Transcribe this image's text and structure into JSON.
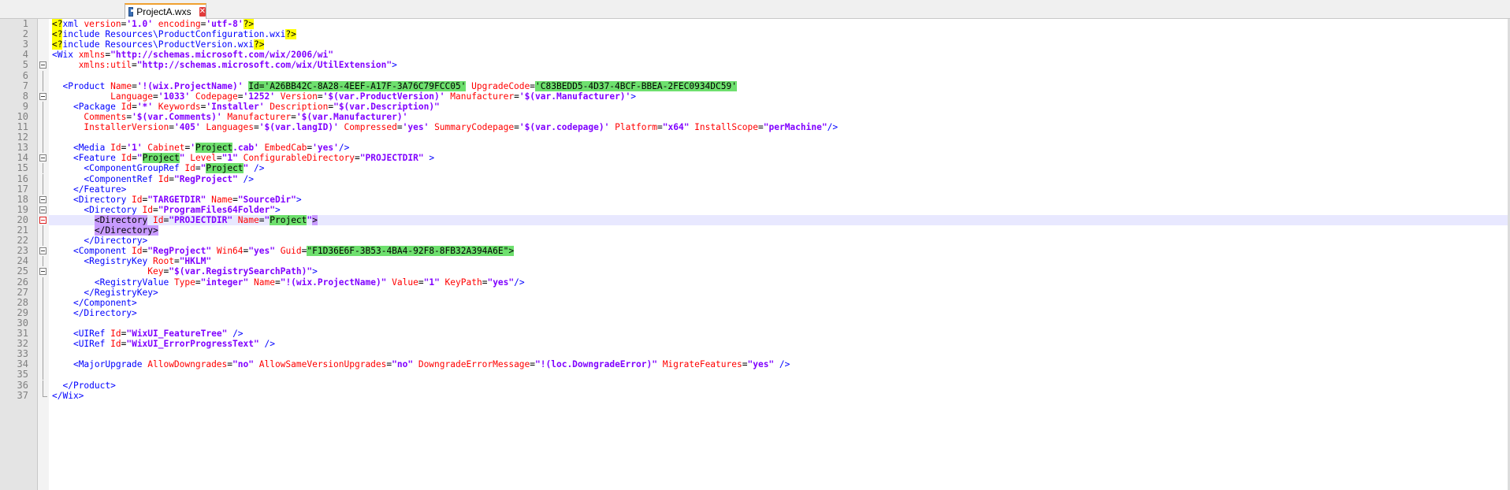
{
  "tab": {
    "label": "ProjectA.wxs",
    "icon": "save-icon",
    "close_icon": "close-icon"
  },
  "colors": {
    "tag": "#0000ff",
    "attr": "#ff0000",
    "value": "#8000ff",
    "highlight_yellow": "#ffff00",
    "highlight_green": "#6ee06e",
    "highlight_purple": "#c89bff"
  },
  "lines": [
    {
      "n": "1",
      "segs": [
        [
          "hl-y",
          "<?"
        ],
        [
          "t-tag",
          "xml "
        ],
        [
          "t-attr",
          "version"
        ],
        [
          "t-txt",
          "="
        ],
        [
          "t-val",
          "'1.0' "
        ],
        [
          "t-attr",
          "encoding"
        ],
        [
          "t-txt",
          "="
        ],
        [
          "t-val",
          "'utf-8'"
        ],
        [
          "hl-y",
          "?>"
        ]
      ]
    },
    {
      "n": "2",
      "segs": [
        [
          "hl-y",
          "<?"
        ],
        [
          "t-tag",
          "include Resources\\ProductConfiguration.wxi"
        ],
        [
          "hl-y",
          "?>"
        ]
      ]
    },
    {
      "n": "3",
      "segs": [
        [
          "hl-y",
          "<?"
        ],
        [
          "t-tag",
          "include Resources\\ProductVersion.wxi"
        ],
        [
          "hl-y",
          "?>"
        ]
      ]
    },
    {
      "n": "4",
      "segs": [
        [
          "t-tag",
          "<Wix "
        ],
        [
          "t-attr",
          "xmlns"
        ],
        [
          "t-txt",
          "="
        ],
        [
          "t-val",
          "\"http://schemas.microsoft.com/wix/2006/wi\""
        ]
      ]
    },
    {
      "n": "5",
      "segs": [
        [
          "t-txt",
          "     "
        ],
        [
          "t-attr",
          "xmlns:util"
        ],
        [
          "t-txt",
          "="
        ],
        [
          "t-val",
          "\"http://schemas.microsoft.com/wix/UtilExtension\""
        ],
        [
          "t-tag",
          ">"
        ]
      ]
    },
    {
      "n": "6",
      "segs": []
    },
    {
      "n": "7",
      "segs": [
        [
          "t-txt",
          "  "
        ],
        [
          "t-tag",
          "<Product "
        ],
        [
          "t-attr",
          "Name"
        ],
        [
          "t-txt",
          "="
        ],
        [
          "t-val",
          "'!(wix.ProjectName)' "
        ],
        [
          "hl-g",
          "Id='A26BB42C-8A28-4EEF-A17F-3A76C79FCC05'"
        ],
        [
          "t-txt",
          " "
        ],
        [
          "t-attr",
          "UpgradeCode"
        ],
        [
          "t-txt",
          "="
        ],
        [
          "hl-g",
          "'C83BEDD5-4D37-4BCF-BBEA-2FEC0934DC59'"
        ]
      ]
    },
    {
      "n": "8",
      "segs": [
        [
          "t-txt",
          "           "
        ],
        [
          "t-attr",
          "Language"
        ],
        [
          "t-txt",
          "="
        ],
        [
          "t-val",
          "'1033' "
        ],
        [
          "t-attr",
          "Codepage"
        ],
        [
          "t-txt",
          "="
        ],
        [
          "t-val",
          "'1252' "
        ],
        [
          "t-attr",
          "Version"
        ],
        [
          "t-txt",
          "="
        ],
        [
          "t-val",
          "'$(var.ProductVersion)' "
        ],
        [
          "t-attr",
          "Manufacturer"
        ],
        [
          "t-txt",
          "="
        ],
        [
          "t-val",
          "'$(var.Manufacturer)'"
        ],
        [
          "t-tag",
          ">"
        ]
      ]
    },
    {
      "n": "9",
      "segs": [
        [
          "t-txt",
          "    "
        ],
        [
          "t-tag",
          "<Package "
        ],
        [
          "t-attr",
          "Id"
        ],
        [
          "t-txt",
          "="
        ],
        [
          "t-val",
          "'*' "
        ],
        [
          "t-attr",
          "Keywords"
        ],
        [
          "t-txt",
          "="
        ],
        [
          "t-val",
          "'Installer' "
        ],
        [
          "t-attr",
          "Description"
        ],
        [
          "t-txt",
          "="
        ],
        [
          "t-val",
          "\"$(var.Description)\""
        ]
      ]
    },
    {
      "n": "10",
      "segs": [
        [
          "t-txt",
          "      "
        ],
        [
          "t-attr",
          "Comments"
        ],
        [
          "t-txt",
          "="
        ],
        [
          "t-val",
          "'$(var.Comments)' "
        ],
        [
          "t-attr",
          "Manufacturer"
        ],
        [
          "t-txt",
          "="
        ],
        [
          "t-val",
          "'$(var.Manufacturer)'"
        ]
      ]
    },
    {
      "n": "11",
      "segs": [
        [
          "t-txt",
          "      "
        ],
        [
          "t-attr",
          "InstallerVersion"
        ],
        [
          "t-txt",
          "="
        ],
        [
          "t-val",
          "'405' "
        ],
        [
          "t-attr",
          "Languages"
        ],
        [
          "t-txt",
          "="
        ],
        [
          "t-val",
          "'$(var.langID)' "
        ],
        [
          "t-attr",
          "Compressed"
        ],
        [
          "t-txt",
          "="
        ],
        [
          "t-val",
          "'yes' "
        ],
        [
          "t-attr",
          "SummaryCodepage"
        ],
        [
          "t-txt",
          "="
        ],
        [
          "t-val",
          "'$(var.codepage)' "
        ],
        [
          "t-attr",
          "Platform"
        ],
        [
          "t-txt",
          "="
        ],
        [
          "t-val",
          "\"x64\" "
        ],
        [
          "t-attr",
          "InstallScope"
        ],
        [
          "t-txt",
          "="
        ],
        [
          "t-val",
          "\"perMachine\""
        ],
        [
          "t-tag",
          "/>"
        ]
      ]
    },
    {
      "n": "12",
      "segs": []
    },
    {
      "n": "13",
      "segs": [
        [
          "t-txt",
          "    "
        ],
        [
          "t-tag",
          "<Media "
        ],
        [
          "t-attr",
          "Id"
        ],
        [
          "t-txt",
          "="
        ],
        [
          "t-val",
          "'1' "
        ],
        [
          "t-attr",
          "Cabinet"
        ],
        [
          "t-txt",
          "="
        ],
        [
          "t-val",
          "'"
        ],
        [
          "hl-g",
          "Project"
        ],
        [
          "t-val",
          ".cab' "
        ],
        [
          "t-attr",
          "EmbedCab"
        ],
        [
          "t-txt",
          "="
        ],
        [
          "t-val",
          "'yes'"
        ],
        [
          "t-tag",
          "/>"
        ]
      ]
    },
    {
      "n": "14",
      "segs": [
        [
          "t-txt",
          "    "
        ],
        [
          "t-tag",
          "<Feature "
        ],
        [
          "t-attr",
          "Id"
        ],
        [
          "t-txt",
          "="
        ],
        [
          "t-val",
          "\""
        ],
        [
          "hl-g",
          "Project"
        ],
        [
          "t-val",
          "\" "
        ],
        [
          "t-attr",
          "Level"
        ],
        [
          "t-txt",
          "="
        ],
        [
          "t-val",
          "\"1\" "
        ],
        [
          "t-attr",
          "ConfigurableDirectory"
        ],
        [
          "t-txt",
          "="
        ],
        [
          "t-val",
          "\"PROJECTDIR\" "
        ],
        [
          "t-tag",
          ">"
        ]
      ]
    },
    {
      "n": "15",
      "segs": [
        [
          "t-txt",
          "      "
        ],
        [
          "t-tag",
          "<ComponentGroupRef "
        ],
        [
          "t-attr",
          "Id"
        ],
        [
          "t-txt",
          "="
        ],
        [
          "t-val",
          "\""
        ],
        [
          "hl-g",
          "Project"
        ],
        [
          "t-val",
          "\" "
        ],
        [
          "t-tag",
          "/>"
        ]
      ]
    },
    {
      "n": "16",
      "segs": [
        [
          "t-txt",
          "      "
        ],
        [
          "t-tag",
          "<ComponentRef "
        ],
        [
          "t-attr",
          "Id"
        ],
        [
          "t-txt",
          "="
        ],
        [
          "t-val",
          "\"RegProject\" "
        ],
        [
          "t-tag",
          "/>"
        ]
      ]
    },
    {
      "n": "17",
      "segs": [
        [
          "t-txt",
          "    "
        ],
        [
          "t-tag",
          "</Feature>"
        ]
      ]
    },
    {
      "n": "18",
      "segs": [
        [
          "t-txt",
          "    "
        ],
        [
          "t-tag",
          "<Directory "
        ],
        [
          "t-attr",
          "Id"
        ],
        [
          "t-txt",
          "="
        ],
        [
          "t-val",
          "\"TARGETDIR\" "
        ],
        [
          "t-attr",
          "Name"
        ],
        [
          "t-txt",
          "="
        ],
        [
          "t-val",
          "\"SourceDir\""
        ],
        [
          "t-tag",
          ">"
        ]
      ]
    },
    {
      "n": "19",
      "segs": [
        [
          "t-txt",
          "      "
        ],
        [
          "t-tag",
          "<Directory "
        ],
        [
          "t-attr",
          "Id"
        ],
        [
          "t-txt",
          "="
        ],
        [
          "t-val",
          "\"ProgramFiles64Folder\""
        ],
        [
          "t-tag",
          ">"
        ]
      ]
    },
    {
      "n": "20",
      "segs": [
        [
          "t-txt",
          "        "
        ],
        [
          "hl-p",
          "<Directory"
        ],
        [
          "t-txt",
          " "
        ],
        [
          "t-attr",
          "Id"
        ],
        [
          "t-txt",
          "="
        ],
        [
          "t-val",
          "\"PROJECTDIR\" "
        ],
        [
          "t-attr",
          "Name"
        ],
        [
          "t-txt",
          "="
        ],
        [
          "t-val",
          "\""
        ],
        [
          "hl-g",
          "Project"
        ],
        [
          "t-val",
          "\""
        ],
        [
          "hl-p",
          ">"
        ]
      ]
    },
    {
      "n": "21",
      "segs": [
        [
          "t-txt",
          "        "
        ],
        [
          "hl-p",
          "</Directory>"
        ]
      ]
    },
    {
      "n": "22",
      "segs": [
        [
          "t-txt",
          "      "
        ],
        [
          "t-tag",
          "</Directory>"
        ]
      ]
    },
    {
      "n": "23",
      "segs": [
        [
          "t-txt",
          "    "
        ],
        [
          "t-tag",
          "<Component "
        ],
        [
          "t-attr",
          "Id"
        ],
        [
          "t-txt",
          "="
        ],
        [
          "t-val",
          "\"RegProject\" "
        ],
        [
          "t-attr",
          "Win64"
        ],
        [
          "t-txt",
          "="
        ],
        [
          "t-val",
          "\"yes\" "
        ],
        [
          "t-attr",
          "Guid"
        ],
        [
          "t-txt",
          "="
        ],
        [
          "hl-g",
          "\"F1D36E6F-3B53-4BA4-92F8-8FB32A394A6E\">"
        ]
      ]
    },
    {
      "n": "24",
      "segs": [
        [
          "t-txt",
          "      "
        ],
        [
          "t-tag",
          "<RegistryKey "
        ],
        [
          "t-attr",
          "Root"
        ],
        [
          "t-txt",
          "="
        ],
        [
          "t-val",
          "\"HKLM\""
        ]
      ]
    },
    {
      "n": "25",
      "segs": [
        [
          "t-txt",
          "                  "
        ],
        [
          "t-attr",
          "Key"
        ],
        [
          "t-txt",
          "="
        ],
        [
          "t-val",
          "\"$(var.RegistrySearchPath)\""
        ],
        [
          "t-tag",
          ">"
        ]
      ]
    },
    {
      "n": "26",
      "segs": [
        [
          "t-txt",
          "        "
        ],
        [
          "t-tag",
          "<RegistryValue "
        ],
        [
          "t-attr",
          "Type"
        ],
        [
          "t-txt",
          "="
        ],
        [
          "t-val",
          "\"integer\" "
        ],
        [
          "t-attr",
          "Name"
        ],
        [
          "t-txt",
          "="
        ],
        [
          "t-val",
          "\"!(wix.ProjectName)\" "
        ],
        [
          "t-attr",
          "Value"
        ],
        [
          "t-txt",
          "="
        ],
        [
          "t-val",
          "\"1\" "
        ],
        [
          "t-attr",
          "KeyPath"
        ],
        [
          "t-txt",
          "="
        ],
        [
          "t-val",
          "\"yes\""
        ],
        [
          "t-tag",
          "/>"
        ]
      ]
    },
    {
      "n": "27",
      "segs": [
        [
          "t-txt",
          "      "
        ],
        [
          "t-tag",
          "</RegistryKey>"
        ]
      ]
    },
    {
      "n": "28",
      "segs": [
        [
          "t-txt",
          "    "
        ],
        [
          "t-tag",
          "</Component>"
        ]
      ]
    },
    {
      "n": "29",
      "segs": [
        [
          "t-txt",
          "    "
        ],
        [
          "t-tag",
          "</Directory>"
        ]
      ]
    },
    {
      "n": "30",
      "segs": []
    },
    {
      "n": "31",
      "segs": [
        [
          "t-txt",
          "    "
        ],
        [
          "t-tag",
          "<UIRef "
        ],
        [
          "t-attr",
          "Id"
        ],
        [
          "t-txt",
          "="
        ],
        [
          "t-val",
          "\"WixUI_FeatureTree\" "
        ],
        [
          "t-tag",
          "/>"
        ]
      ]
    },
    {
      "n": "32",
      "segs": [
        [
          "t-txt",
          "    "
        ],
        [
          "t-tag",
          "<UIRef "
        ],
        [
          "t-attr",
          "Id"
        ],
        [
          "t-txt",
          "="
        ],
        [
          "t-val",
          "\"WixUI_ErrorProgressText\" "
        ],
        [
          "t-tag",
          "/>"
        ]
      ]
    },
    {
      "n": "33",
      "segs": []
    },
    {
      "n": "34",
      "segs": [
        [
          "t-txt",
          "    "
        ],
        [
          "t-tag",
          "<MajorUpgrade "
        ],
        [
          "t-attr",
          "AllowDowngrades"
        ],
        [
          "t-txt",
          "="
        ],
        [
          "t-val",
          "\"no\" "
        ],
        [
          "t-attr",
          "AllowSameVersionUpgrades"
        ],
        [
          "t-txt",
          "="
        ],
        [
          "t-val",
          "\"no\" "
        ],
        [
          "t-attr",
          "DowngradeErrorMessage"
        ],
        [
          "t-txt",
          "="
        ],
        [
          "t-val",
          "\"!(loc.DowngradeError)\" "
        ],
        [
          "t-attr",
          "MigrateFeatures"
        ],
        [
          "t-txt",
          "="
        ],
        [
          "t-val",
          "\"yes\" "
        ],
        [
          "t-tag",
          "/>"
        ]
      ]
    },
    {
      "n": "35",
      "segs": []
    },
    {
      "n": "36",
      "segs": [
        [
          "t-txt",
          "  "
        ],
        [
          "t-tag",
          "</Product>"
        ]
      ]
    },
    {
      "n": "37",
      "segs": [
        [
          "t-tag",
          "</Wix>"
        ]
      ]
    }
  ]
}
